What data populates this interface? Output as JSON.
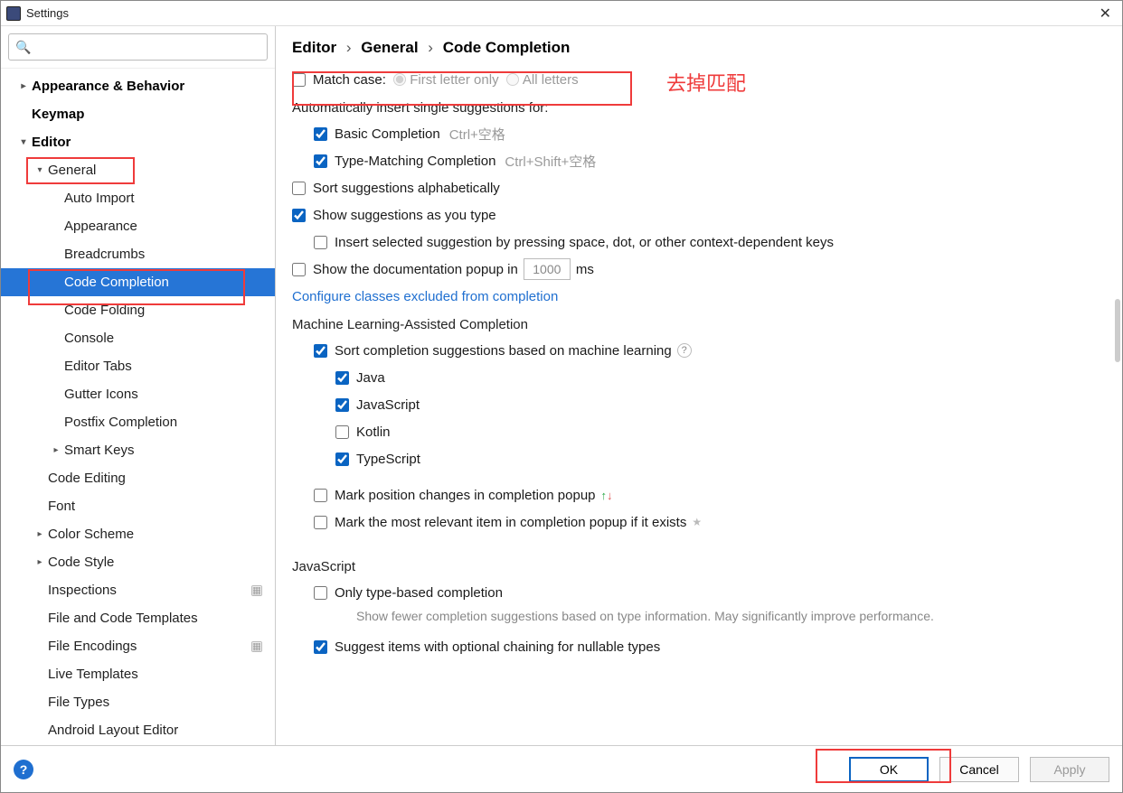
{
  "window": {
    "title": "Settings"
  },
  "search": {
    "placeholder": ""
  },
  "sidebar": {
    "items": [
      {
        "label": "Appearance & Behavior",
        "level": 0,
        "bold": true,
        "arrow": "right"
      },
      {
        "label": "Keymap",
        "level": 0,
        "bold": true
      },
      {
        "label": "Editor",
        "level": 0,
        "bold": true,
        "arrow": "down"
      },
      {
        "label": "General",
        "level": 1,
        "arrow": "down"
      },
      {
        "label": "Auto Import",
        "level": 2
      },
      {
        "label": "Appearance",
        "level": 2
      },
      {
        "label": "Breadcrumbs",
        "level": 2
      },
      {
        "label": "Code Completion",
        "level": 2,
        "selected": true
      },
      {
        "label": "Code Folding",
        "level": 2
      },
      {
        "label": "Console",
        "level": 2
      },
      {
        "label": "Editor Tabs",
        "level": 2
      },
      {
        "label": "Gutter Icons",
        "level": 2
      },
      {
        "label": "Postfix Completion",
        "level": 2
      },
      {
        "label": "Smart Keys",
        "level": 2,
        "arrow": "right"
      },
      {
        "label": "Code Editing",
        "level": 1
      },
      {
        "label": "Font",
        "level": 1
      },
      {
        "label": "Color Scheme",
        "level": 1,
        "arrow": "right"
      },
      {
        "label": "Code Style",
        "level": 1,
        "arrow": "right"
      },
      {
        "label": "Inspections",
        "level": 1,
        "proj": true
      },
      {
        "label": "File and Code Templates",
        "level": 1
      },
      {
        "label": "File Encodings",
        "level": 1,
        "proj": true
      },
      {
        "label": "Live Templates",
        "level": 1
      },
      {
        "label": "File Types",
        "level": 1
      },
      {
        "label": "Android Layout Editor",
        "level": 1
      }
    ]
  },
  "breadcrumb": {
    "a": "Editor",
    "b": "General",
    "c": "Code Completion"
  },
  "annotation": {
    "removeMatch": "去掉匹配"
  },
  "options": {
    "matchCase": {
      "label": "Match case:",
      "checked": false,
      "radio1": "First letter only",
      "radio2": "All letters"
    },
    "autoInsertHeader": "Automatically insert single suggestions for:",
    "basic": {
      "label": "Basic Completion",
      "shortcut": "Ctrl+空格",
      "checked": true
    },
    "typeMatch": {
      "label": "Type-Matching Completion",
      "shortcut": "Ctrl+Shift+空格",
      "checked": true
    },
    "sortAlpha": {
      "label": "Sort suggestions alphabetically",
      "checked": false
    },
    "showAsType": {
      "label": "Show suggestions as you type",
      "checked": true
    },
    "insertOnSpace": {
      "label": "Insert selected suggestion by pressing space, dot, or other context-dependent keys",
      "checked": false
    },
    "showDoc": {
      "label_before": "Show the documentation popup in",
      "value": "1000",
      "label_after": "ms",
      "checked": false
    },
    "configureLink": "Configure classes excluded from completion",
    "mlHeader": "Machine Learning-Assisted Completion",
    "mlSort": {
      "label": "Sort completion suggestions based on machine learning",
      "checked": true
    },
    "java": {
      "label": "Java",
      "checked": true
    },
    "javascript": {
      "label": "JavaScript",
      "checked": true
    },
    "kotlin": {
      "label": "Kotlin",
      "checked": false
    },
    "typescript": {
      "label": "TypeScript",
      "checked": true
    },
    "markPos": {
      "label": "Mark position changes in completion popup",
      "checked": false
    },
    "markRelevant": {
      "label": "Mark the most relevant item in completion popup if it exists",
      "checked": false
    },
    "jsHeader": "JavaScript",
    "onlyType": {
      "label": "Only type-based completion",
      "checked": false,
      "desc": "Show fewer completion suggestions based on type information. May significantly improve performance."
    },
    "suggestOptional": {
      "label": "Suggest items with optional chaining for nullable types",
      "checked": true
    }
  },
  "footer": {
    "ok": "OK",
    "cancel": "Cancel",
    "apply": "Apply"
  }
}
